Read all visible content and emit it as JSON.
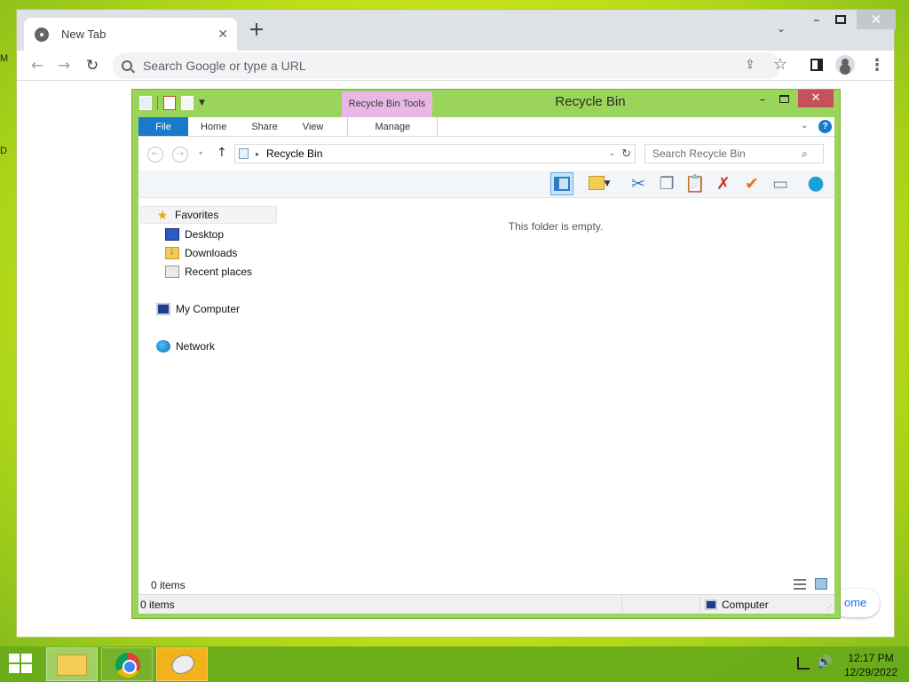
{
  "chrome": {
    "tab_title": "New Tab",
    "tab_close": "✕",
    "new_tab": "+",
    "tab_search": "⌄",
    "window_min": "–",
    "window_close": "✕",
    "back": "←",
    "forward": "→",
    "reload": "↻",
    "omnibox_placeholder": "Search Google or type a URL",
    "share": "⇪",
    "bookmark": "☆",
    "menu": "⋮",
    "ntp_chip_text": "ome"
  },
  "explorer": {
    "context_tab_header": "Recycle Bin Tools",
    "title": "Recycle Bin",
    "min": "–",
    "close": "✕",
    "ribbon_tabs": {
      "file": "File",
      "home": "Home",
      "share": "Share",
      "view": "View",
      "manage": "Manage"
    },
    "ribbon_expand": "⌄",
    "help": "?",
    "address": {
      "back": "←",
      "forward": "→",
      "recent_drop": "▾",
      "up": "↑",
      "separator": "▸",
      "path": "Recycle Bin",
      "dropdown": "⌄",
      "refresh": "↻"
    },
    "search_placeholder": "Search Recycle Bin",
    "search_icon": "⌕",
    "command_bar": {
      "cut": "✂",
      "copy": "❐",
      "paste": "📋",
      "delete": "✗",
      "check": "✔",
      "rename": "▭",
      "globe": "●"
    },
    "nav_pane": {
      "favorites": "Favorites",
      "desktop": "Desktop",
      "downloads": "Downloads",
      "recent_places": "Recent places",
      "my_computer": "My Computer",
      "network": "Network"
    },
    "empty_message": "This folder is empty.",
    "pane_item_count": "0 items",
    "status_item_count": "0 items",
    "status_location": "Computer",
    "grip": "⋰"
  },
  "taskbar": {
    "time": "12:17 PM",
    "date": "12/29/2022",
    "volume": "🔊"
  },
  "desktop": {
    "edge_letter_1": "M",
    "edge_letter_2": "D"
  },
  "colors": {
    "explorer_frame": "#9bd45a",
    "context_tab": "#e9b7e6",
    "file_tab": "#1979ca",
    "close_button": "#c7505d",
    "taskbar": "#67aa19"
  }
}
